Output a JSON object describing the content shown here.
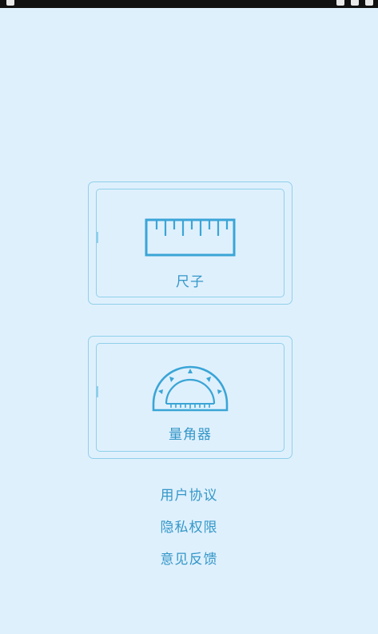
{
  "colors": {
    "background": "#dff0fd",
    "accent": "#3497c8",
    "border": "#8fd0ea"
  },
  "cards": [
    {
      "label": "尺子",
      "icon": "ruler-icon"
    },
    {
      "label": "量角器",
      "icon": "protractor-icon"
    }
  ],
  "links": [
    "用户协议",
    "隐私权限",
    "意见反馈"
  ]
}
